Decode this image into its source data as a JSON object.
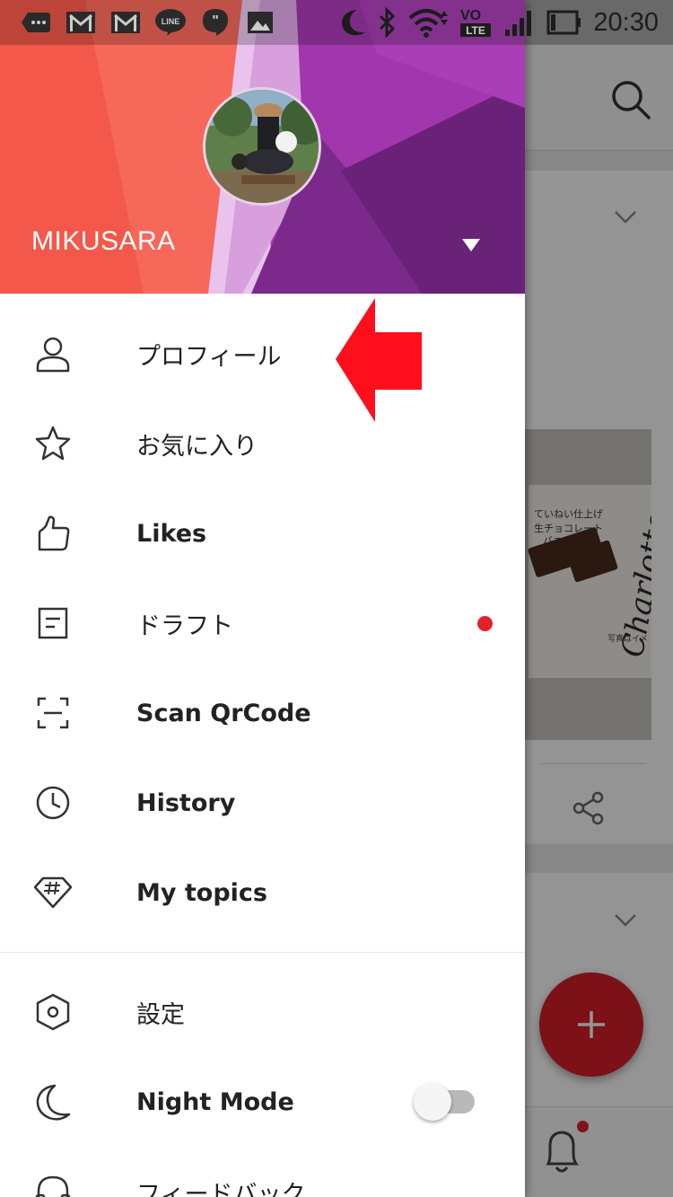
{
  "status_bar": {
    "time": "20:30",
    "left_icons": [
      "chat-bubble-icon",
      "gmail-icon",
      "gmail-icon",
      "line-icon",
      "quote-bubble-icon",
      "image-icon"
    ],
    "right_icons": [
      "moon-icon",
      "bluetooth-icon",
      "wifi-icon",
      "volte-icon",
      "signal-icon",
      "battery-icon"
    ],
    "volte_top": "VO",
    "volte_bottom": "LTE"
  },
  "drawer": {
    "header": {
      "username": "MIKUSARA",
      "colors": {
        "left": "#f3584a",
        "right": "#9a33a8"
      }
    },
    "menu_items": [
      {
        "label": "プロフィール",
        "icon": "person-icon",
        "bold": false
      },
      {
        "label": "お気に入り",
        "icon": "star-icon",
        "bold": false
      },
      {
        "label": "Likes",
        "icon": "thumbs-up-icon",
        "bold": true
      },
      {
        "label": "ドラフト",
        "icon": "draft-icon",
        "bold": false,
        "badge_color": "#e0222d"
      },
      {
        "label": "Scan QrCode",
        "icon": "scan-icon",
        "bold": true
      },
      {
        "label": "History",
        "icon": "clock-icon",
        "bold": true
      },
      {
        "label": "My topics",
        "icon": "hashtag-diamond-icon",
        "bold": true
      }
    ],
    "secondary_items": [
      {
        "label": "設定",
        "icon": "settings-hexagon-icon",
        "bold": false
      },
      {
        "label": "Night Mode",
        "icon": "moon-icon",
        "bold": true,
        "toggle_on": false
      },
      {
        "label": "フィードバック",
        "icon": "headset-icon",
        "bold": false
      }
    ]
  },
  "background": {
    "photo_text": {
      "script": "Charlotte",
      "line1": "ていねい仕上げ",
      "line2": "生チョコレート",
      "line3": "バニラ",
      "caption": "写真はイメ"
    },
    "accent_color": "#d81e2a"
  },
  "annotation": {
    "arrow_color": "#ff0f1b"
  }
}
